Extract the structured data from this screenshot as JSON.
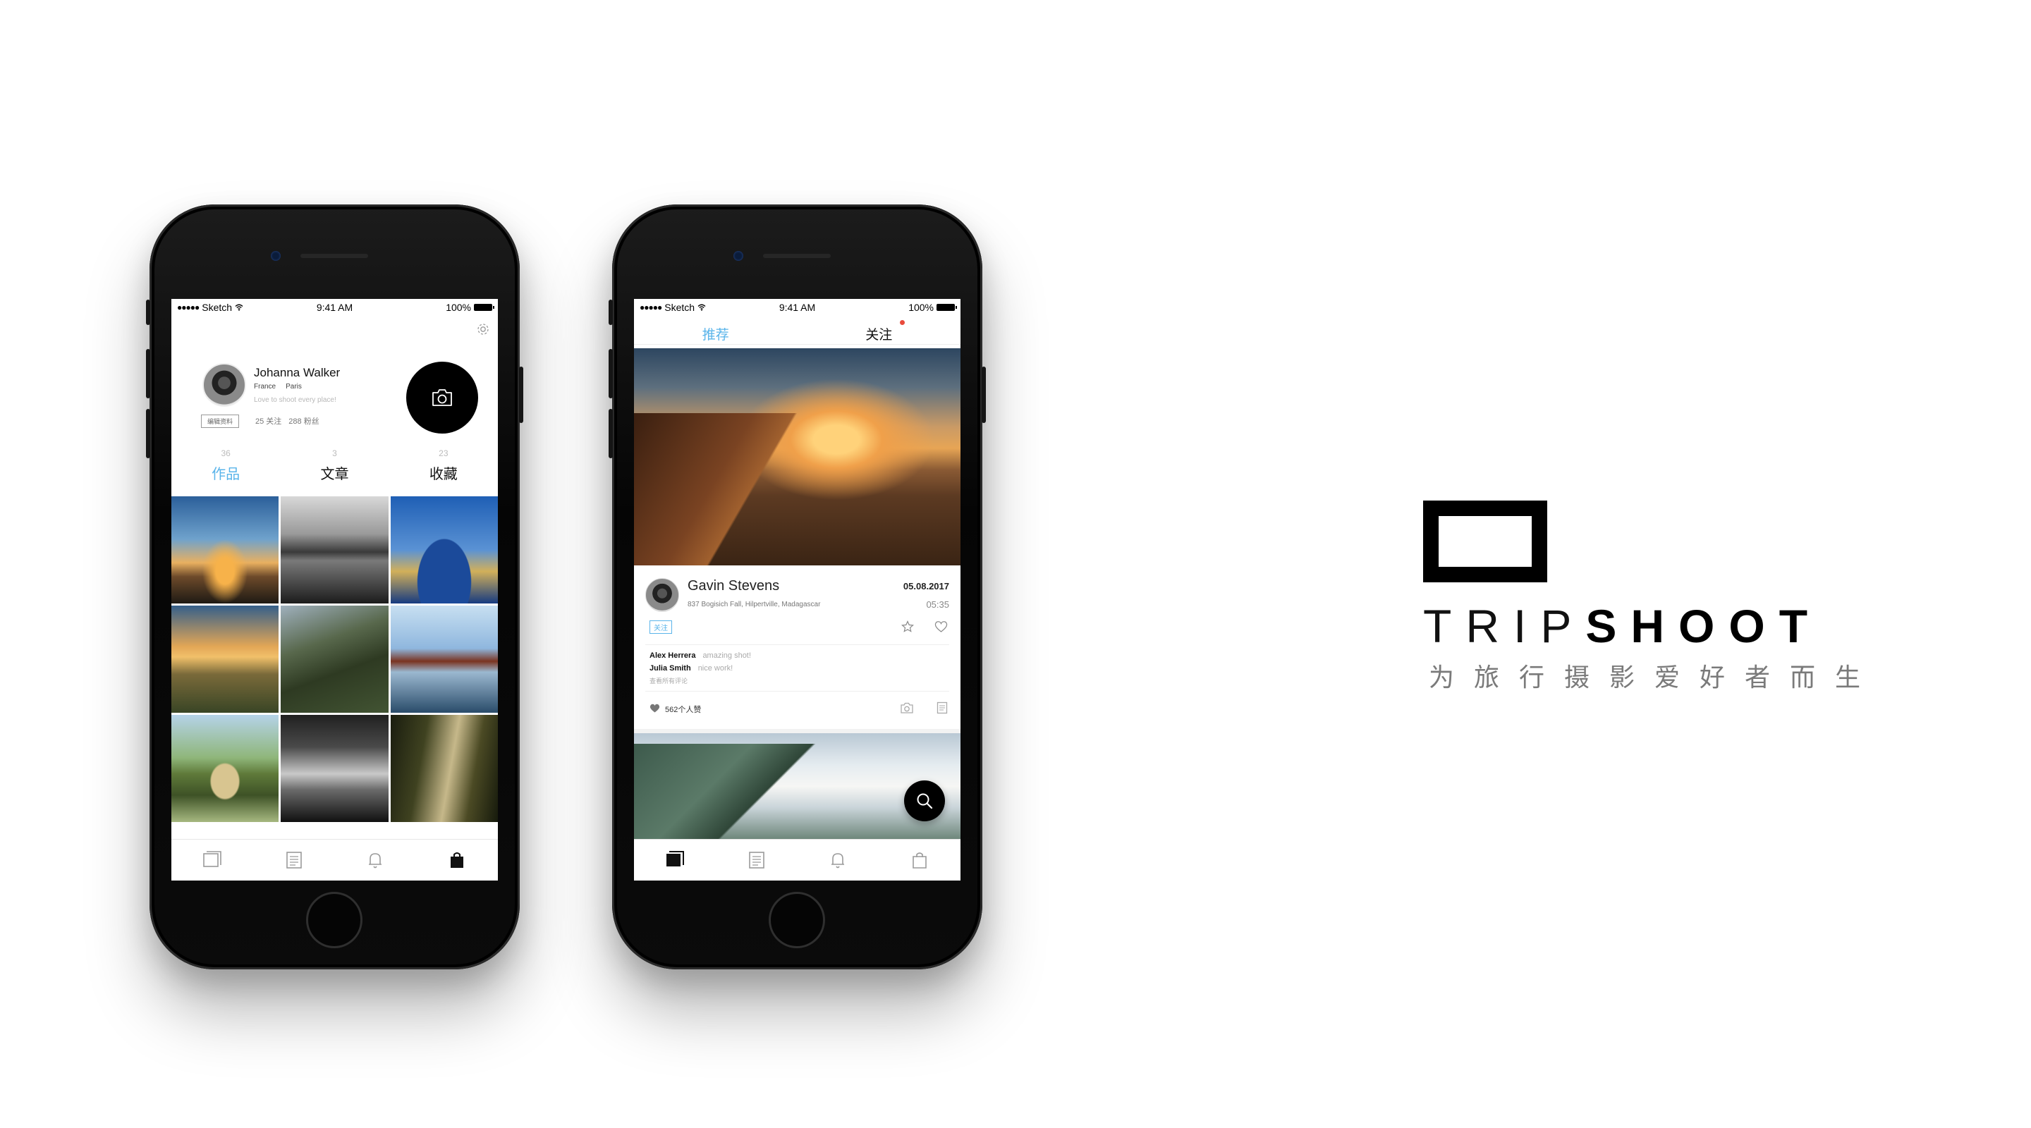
{
  "status_bar": {
    "carrier": "Sketch",
    "time": "9:41 AM",
    "battery": "100%"
  },
  "profile_screen": {
    "user_name": "Johanna Walker",
    "country": "France",
    "city": "Paris",
    "bio": "Love to shoot every place!",
    "edit_profile_label": "编辑资料",
    "following": "25 关注",
    "followers": "288 粉丝",
    "stats": [
      {
        "count": "36",
        "label": "作品"
      },
      {
        "count": "3",
        "label": "文章"
      },
      {
        "count": "23",
        "label": "收藏"
      }
    ],
    "accent_color": "#5ab4ea",
    "photos": [
      "sunset-gate",
      "bw-sea",
      "temple-roof",
      "great-wall-sunset",
      "green-mountains",
      "palace-lake",
      "stone-bridge",
      "bw-mountains",
      "forest-sunbeams"
    ],
    "tab_icons": [
      "gallery-icon",
      "article-icon",
      "bell-icon",
      "bag-icon"
    ],
    "active_tab": 3
  },
  "feed_screen": {
    "tabs": [
      {
        "label": "推荐",
        "active": true
      },
      {
        "label": "关注",
        "active": false,
        "badge": true
      }
    ],
    "post": {
      "author": "Gavin Stevens",
      "date": "05.08.2017",
      "time": "05:35",
      "address": "837 Bogisich Fall, Hilpertville, Madagascar",
      "follow_label": "关注",
      "comments": [
        {
          "user": "Alex Herrera",
          "text": "amazing shot!"
        },
        {
          "user": "Julia Smith",
          "text": "nice work!"
        }
      ],
      "view_all_comments": "查看所有评论",
      "likes": "562个人赞"
    },
    "tab_icons": [
      "gallery-icon",
      "article-icon",
      "bell-icon",
      "bag-icon"
    ],
    "active_tab": 0
  },
  "brand": {
    "title_light": "TRIP",
    "title_bold": "SHOOT",
    "tagline": "为旅行摄影爱好者而生"
  }
}
